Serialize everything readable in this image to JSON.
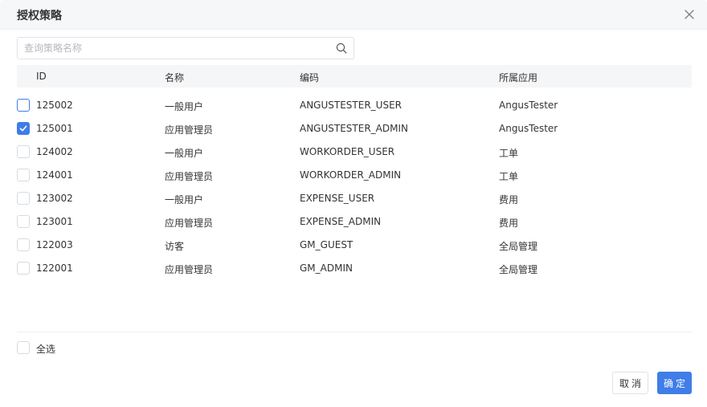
{
  "dialog": {
    "title": "授权策略"
  },
  "search": {
    "placeholder": "查询策略名称"
  },
  "table": {
    "headers": {
      "id": "ID",
      "name": "名称",
      "code": "编码",
      "app": "所属应用"
    },
    "rows": [
      {
        "id": "125002",
        "name": "一般用户",
        "code": "ANGUSTESTER_USER",
        "app": "AngusTester",
        "checked": false,
        "focused": true
      },
      {
        "id": "125001",
        "name": "应用管理员",
        "code": "ANGUSTESTER_ADMIN",
        "app": "AngusTester",
        "checked": true,
        "focused": false
      },
      {
        "id": "124002",
        "name": "一般用户",
        "code": "WORKORDER_USER",
        "app": "工单",
        "checked": false,
        "focused": false
      },
      {
        "id": "124001",
        "name": "应用管理员",
        "code": "WORKORDER_ADMIN",
        "app": "工单",
        "checked": false,
        "focused": false
      },
      {
        "id": "123002",
        "name": "一般用户",
        "code": "EXPENSE_USER",
        "app": "费用",
        "checked": false,
        "focused": false
      },
      {
        "id": "123001",
        "name": "应用管理员",
        "code": "EXPENSE_ADMIN",
        "app": "费用",
        "checked": false,
        "focused": false
      },
      {
        "id": "122003",
        "name": "访客",
        "code": "GM_GUEST",
        "app": "全局管理",
        "checked": false,
        "focused": false
      },
      {
        "id": "122001",
        "name": "应用管理员",
        "code": "GM_ADMIN",
        "app": "全局管理",
        "checked": false,
        "focused": false
      }
    ]
  },
  "footer": {
    "select_all_label": "全选",
    "cancel_label": "取消",
    "ok_label": "确定"
  },
  "colors": {
    "primary": "#3f7de8",
    "header_bg": "#f6f7f9",
    "table_head_bg": "#f5f6f8"
  },
  "icons": {
    "close": "close-icon",
    "search": "search-icon",
    "check": "checkmark-icon"
  }
}
